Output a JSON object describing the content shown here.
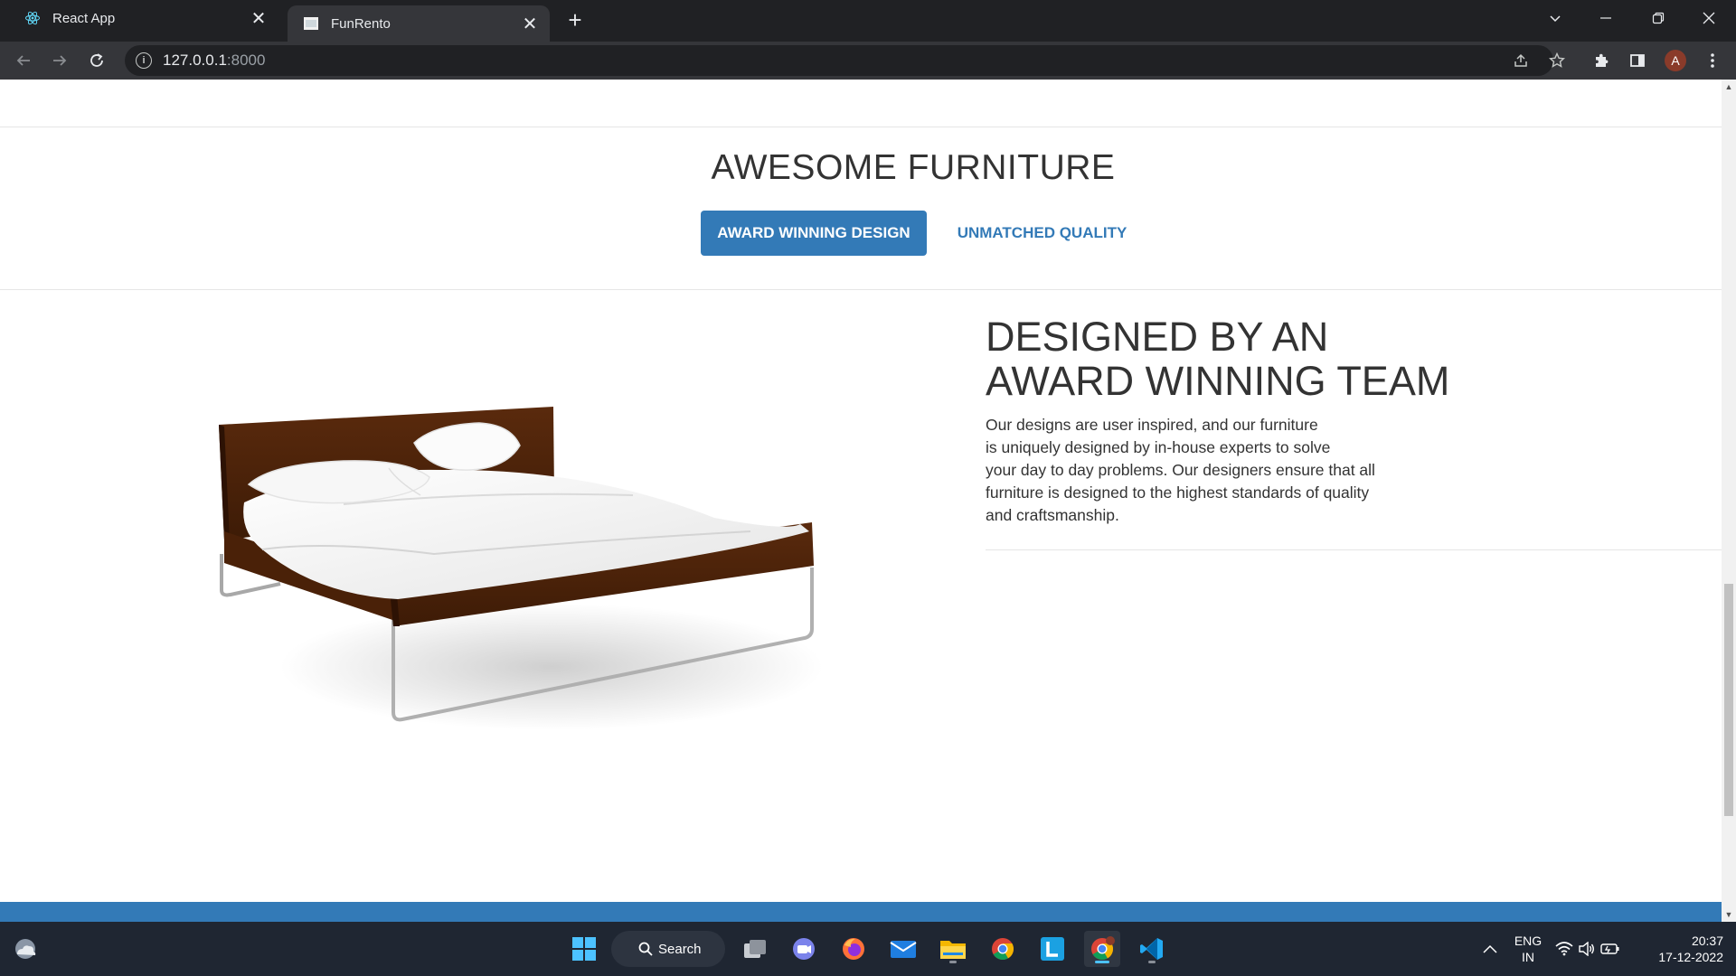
{
  "browser": {
    "tabs": [
      {
        "title": "React App",
        "favicon": "react-icon",
        "active": false
      },
      {
        "title": "FunRento",
        "favicon": "page-favicon",
        "active": true
      }
    ],
    "url_host": "127.0.0.1",
    "url_port": ":8000",
    "profile_initial": "A"
  },
  "page": {
    "section_title": "AWESOME FURNITURE",
    "tabs": [
      {
        "label": "AWARD WINNING DESIGN",
        "active": true
      },
      {
        "label": "UNMATCHED QUALITY",
        "active": false
      }
    ],
    "feature": {
      "heading_line1": "DESIGNED BY AN",
      "heading_line2": "AWARD WINNING TEAM",
      "text_lines": [
        "Our designs are user inspired, and our furniture",
        "is uniquely designed by in-house experts to solve",
        "your day to day problems. Our designers ensure that all",
        "furniture is designed to the highest standards of quality",
        "and craftsmanship."
      ]
    },
    "image": "bed-image"
  },
  "taskbar": {
    "search_label": "Search",
    "apps": [
      "start-icon",
      "search",
      "task-view-icon",
      "chat-icon",
      "firefox-icon",
      "mail-icon",
      "file-explorer-icon",
      "chrome-icon",
      "l-app-icon",
      "chrome-profile-icon",
      "vscode-icon"
    ],
    "lang_line1": "ENG",
    "lang_line2": "IN",
    "time": "20:37",
    "date": "17-12-2022"
  },
  "colors": {
    "accent": "#337ab7",
    "text": "#333333",
    "chrome_dark": "#202124",
    "chrome_toolbar": "#35363a",
    "taskbar": "#1f2632"
  }
}
